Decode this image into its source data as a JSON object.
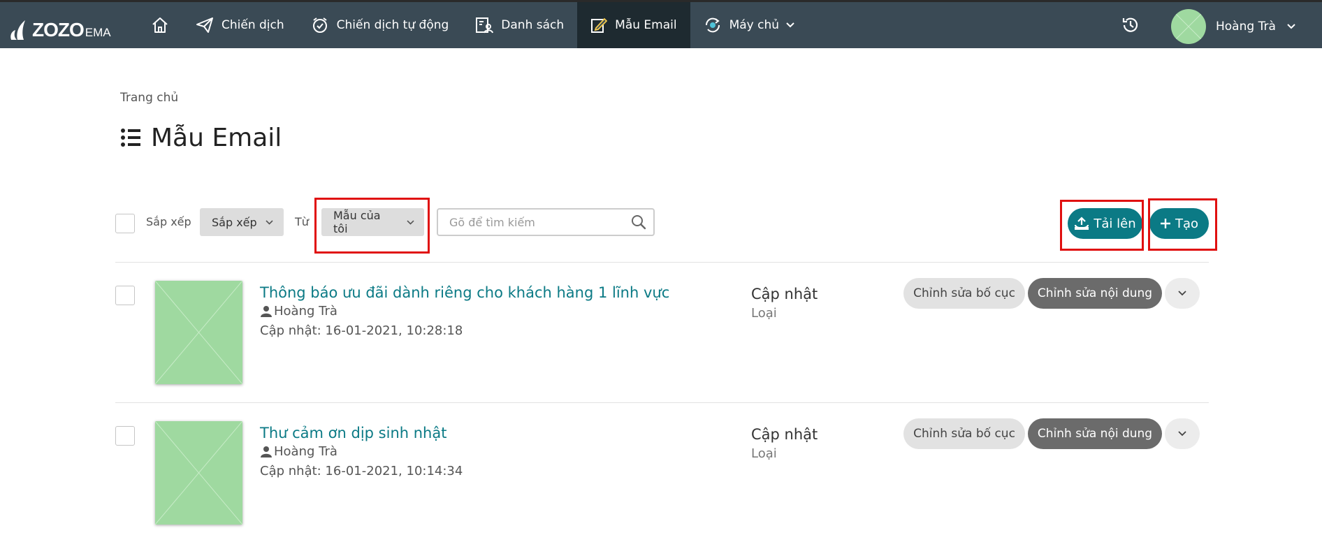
{
  "topbar": {
    "logo": {
      "main": "ZOZO",
      "sub": "EMA"
    },
    "nav": [
      {
        "label": ""
      },
      {
        "label": "Chiến dịch"
      },
      {
        "label": "Chiến dịch tự động"
      },
      {
        "label": "Danh sách"
      },
      {
        "label": "Mẫu Email"
      },
      {
        "label": "Máy chủ"
      }
    ],
    "user": {
      "name": "Hoàng Trà"
    }
  },
  "breadcrumb": "Trang chủ",
  "page_title": "Mẫu Email",
  "toolbar": {
    "sort_label": "Sắp xếp",
    "sort_dropdown": "Sắp xếp",
    "from_label": "Từ",
    "from_dropdown": "Mẫu của tôi",
    "search_placeholder": "Gõ để tìm kiếm",
    "upload_label": "Tải lên",
    "create_label": "Tạo"
  },
  "templates": [
    {
      "title": "Thông báo ưu đãi dành riêng cho khách hàng 1 lĩnh vực",
      "author": "Hoàng Trà",
      "updated": "Cập nhật: 16-01-2021, 10:28:18",
      "status": "Cập nhật",
      "type": "Loại",
      "edit_layout": "Chỉnh sửa bố cục",
      "edit_content": "Chỉnh sửa nội dung"
    },
    {
      "title": "Thư cảm ơn dịp sinh nhật",
      "author": "Hoàng Trà",
      "updated": "Cập nhật: 16-01-2021, 10:14:34",
      "status": "Cập nhật",
      "type": "Loại",
      "edit_layout": "Chỉnh sửa bố cục",
      "edit_content": "Chỉnh sửa nội dung"
    }
  ],
  "colors": {
    "topbar": "#3a4a55",
    "active_nav": "#1e2a30",
    "accent": "#0b7a85",
    "highlight": "#e01010",
    "thumbnail": "#9fd9a0"
  }
}
